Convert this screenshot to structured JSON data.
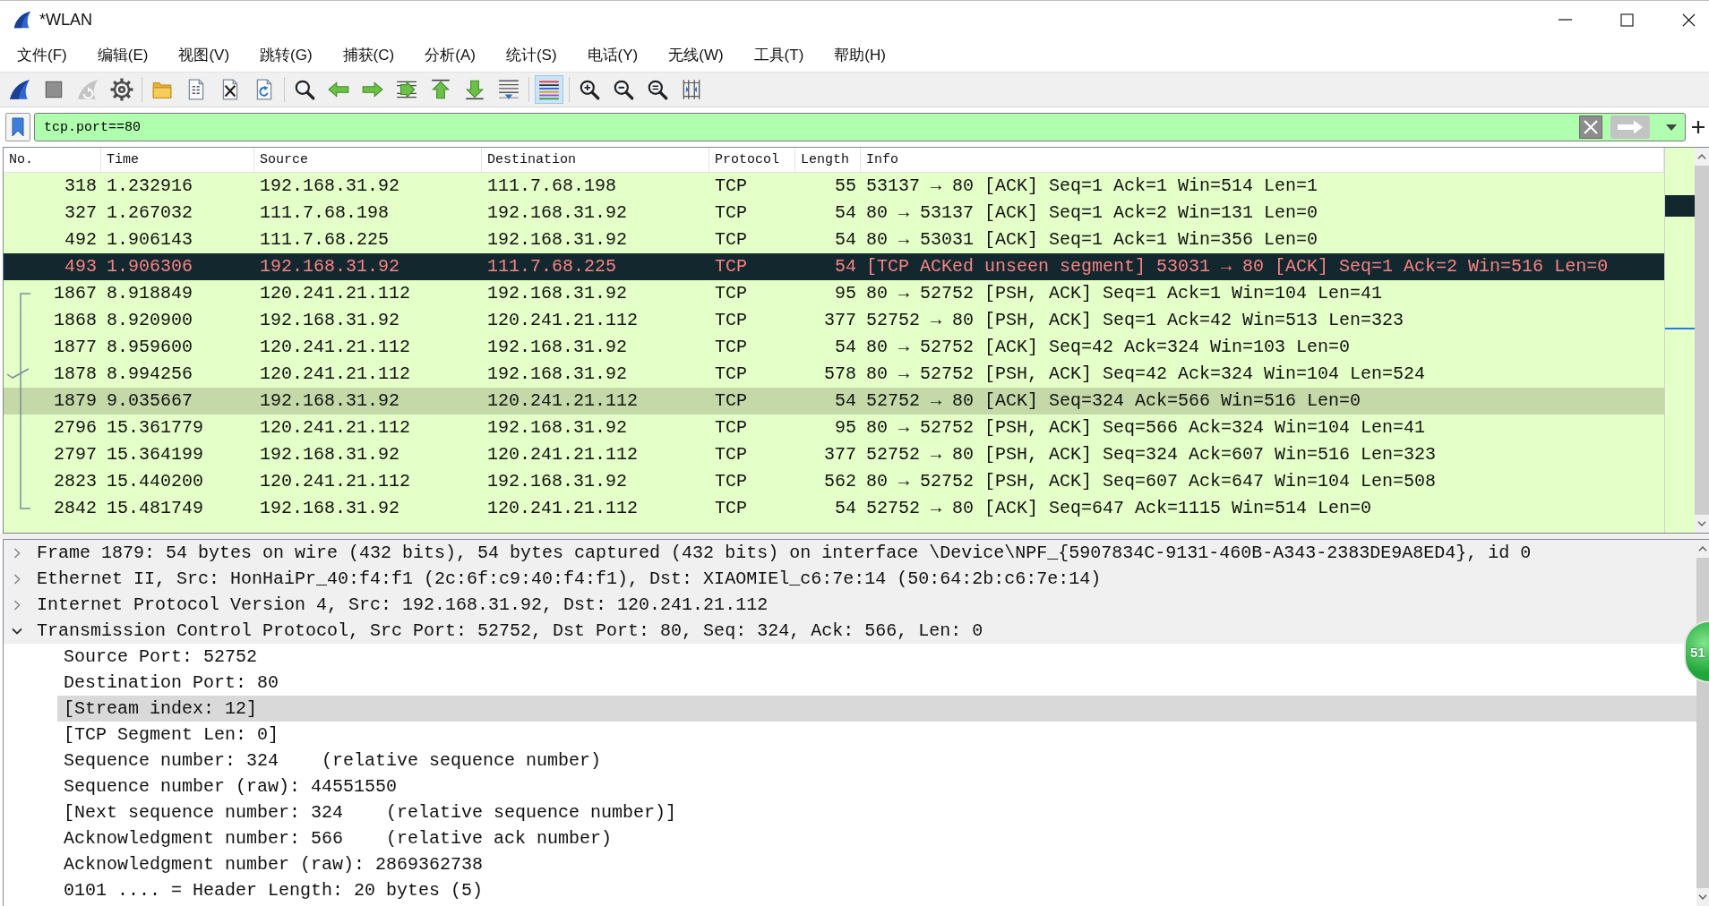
{
  "window": {
    "title": "*WLAN"
  },
  "menu": [
    "文件(F)",
    "编辑(E)",
    "视图(V)",
    "跳转(G)",
    "捕获(C)",
    "分析(A)",
    "统计(S)",
    "电话(Y)",
    "无线(W)",
    "工具(T)",
    "帮助(H)"
  ],
  "toolbar": [
    {
      "buttons": [
        {
          "kind": "start",
          "pressed": false
        },
        {
          "kind": "stop",
          "pressed": false
        },
        {
          "kind": "restart",
          "pressed": false
        },
        {
          "kind": "options",
          "pressed": false
        }
      ]
    },
    {
      "buttons": [
        {
          "kind": "open",
          "pressed": false
        },
        {
          "kind": "save",
          "pressed": false
        },
        {
          "kind": "close",
          "pressed": false
        },
        {
          "kind": "reload",
          "pressed": false
        }
      ]
    },
    {
      "buttons": [
        {
          "kind": "find",
          "pressed": false
        },
        {
          "kind": "back",
          "pressed": false
        },
        {
          "kind": "forward",
          "pressed": false
        },
        {
          "kind": "goto",
          "pressed": false
        },
        {
          "kind": "first",
          "pressed": false
        },
        {
          "kind": "last",
          "pressed": false
        },
        {
          "kind": "autoscroll",
          "pressed": false
        }
      ]
    },
    {
      "buttons": [
        {
          "kind": "colorize",
          "pressed": true
        }
      ]
    },
    {
      "buttons": [
        {
          "kind": "zoomin",
          "pressed": false
        },
        {
          "kind": "zoomout",
          "pressed": false
        },
        {
          "kind": "zoomreset",
          "pressed": false
        },
        {
          "kind": "resize",
          "pressed": false
        }
      ]
    }
  ],
  "display_filter": {
    "value": "tcp.port==80",
    "valid": true
  },
  "packet_list": {
    "columns": [
      "No.",
      "Time",
      "Source",
      "Destination",
      "Protocol",
      "Length",
      "Info"
    ],
    "rows": [
      {
        "no": "318",
        "time": "1.232916",
        "source": "192.168.31.92",
        "destination": "111.7.68.198",
        "protocol": "TCP",
        "length": "55",
        "info": "53137 → 80 [ACK] Seq=1 Ack=1 Win=514 Len=1",
        "kind": "normal",
        "selected": false,
        "related": false,
        "acked": false
      },
      {
        "no": "327",
        "time": "1.267032",
        "source": "111.7.68.198",
        "destination": "192.168.31.92",
        "protocol": "TCP",
        "length": "54",
        "info": "80 → 53137 [ACK] Seq=1 Ack=2 Win=131 Len=0",
        "kind": "normal",
        "selected": false,
        "related": false,
        "acked": false
      },
      {
        "no": "492",
        "time": "1.906143",
        "source": "111.7.68.225",
        "destination": "192.168.31.92",
        "protocol": "TCP",
        "length": "54",
        "info": "80 → 53031 [ACK] Seq=1 Ack=1 Win=356 Len=0",
        "kind": "normal",
        "selected": false,
        "related": false,
        "acked": false
      },
      {
        "no": "493",
        "time": "1.906306",
        "source": "192.168.31.92",
        "destination": "111.7.68.225",
        "protocol": "TCP",
        "length": "54",
        "info": "[TCP ACKed unseen segment] 53031 → 80 [ACK] Seq=1 Ack=2 Win=516 Len=0",
        "kind": "bad",
        "selected": false,
        "related": false,
        "acked": false
      },
      {
        "no": "1867",
        "time": "8.918849",
        "source": "120.241.21.112",
        "destination": "192.168.31.92",
        "protocol": "TCP",
        "length": "95",
        "info": "80 → 52752 [PSH, ACK] Seq=1 Ack=1 Win=104 Len=41",
        "kind": "normal",
        "selected": false,
        "related": true,
        "acked": false
      },
      {
        "no": "1868",
        "time": "8.920900",
        "source": "192.168.31.92",
        "destination": "120.241.21.112",
        "protocol": "TCP",
        "length": "377",
        "info": "52752 → 80 [PSH, ACK] Seq=1 Ack=42 Win=513 Len=323",
        "kind": "normal",
        "selected": false,
        "related": true,
        "acked": false
      },
      {
        "no": "1877",
        "time": "8.959600",
        "source": "120.241.21.112",
        "destination": "192.168.31.92",
        "protocol": "TCP",
        "length": "54",
        "info": "80 → 52752 [ACK] Seq=42 Ack=324 Win=103 Len=0",
        "kind": "normal",
        "selected": false,
        "related": true,
        "acked": false
      },
      {
        "no": "1878",
        "time": "8.994256",
        "source": "120.241.21.112",
        "destination": "192.168.31.92",
        "protocol": "TCP",
        "length": "578",
        "info": "80 → 52752 [PSH, ACK] Seq=42 Ack=324 Win=104 Len=524",
        "kind": "normal",
        "selected": false,
        "related": true,
        "acked": true
      },
      {
        "no": "1879",
        "time": "9.035667",
        "source": "192.168.31.92",
        "destination": "120.241.21.112",
        "protocol": "TCP",
        "length": "54",
        "info": "52752 → 80 [ACK] Seq=324 Ack=566 Win=516 Len=0",
        "kind": "normal",
        "selected": true,
        "related": true,
        "acked": false
      },
      {
        "no": "2796",
        "time": "15.361779",
        "source": "120.241.21.112",
        "destination": "192.168.31.92",
        "protocol": "TCP",
        "length": "95",
        "info": "80 → 52752 [PSH, ACK] Seq=566 Ack=324 Win=104 Len=41",
        "kind": "normal",
        "selected": false,
        "related": true,
        "acked": false
      },
      {
        "no": "2797",
        "time": "15.364199",
        "source": "192.168.31.92",
        "destination": "120.241.21.112",
        "protocol": "TCP",
        "length": "377",
        "info": "52752 → 80 [PSH, ACK] Seq=324 Ack=607 Win=516 Len=323",
        "kind": "normal",
        "selected": false,
        "related": true,
        "acked": false
      },
      {
        "no": "2823",
        "time": "15.440200",
        "source": "120.241.21.112",
        "destination": "192.168.31.92",
        "protocol": "TCP",
        "length": "562",
        "info": "80 → 52752 [PSH, ACK] Seq=607 Ack=647 Win=104 Len=508",
        "kind": "normal",
        "selected": false,
        "related": true,
        "acked": false
      },
      {
        "no": "2842",
        "time": "15.481749",
        "source": "192.168.31.92",
        "destination": "120.241.21.112",
        "protocol": "TCP",
        "length": "54",
        "info": "52752 → 80 [ACK] Seq=647 Ack=1115 Win=514 Len=0",
        "kind": "normal",
        "selected": false,
        "related": true,
        "acked": false
      }
    ]
  },
  "details": [
    {
      "text": "Frame 1879: 54 bytes on wire (432 bits), 54 bytes captured (432 bits) on interface \\Device\\NPF_{5907834C-9131-460B-A343-2383DE9A8ED4}, id 0",
      "expanded": false,
      "selected": false
    },
    {
      "text": "Ethernet II, Src: HonHaiPr_40:f4:f1 (2c:6f:c9:40:f4:f1), Dst: XIAOMIEl_c6:7e:14 (50:64:2b:c6:7e:14)",
      "expanded": false,
      "selected": false
    },
    {
      "text": "Internet Protocol Version 4, Src: 192.168.31.92, Dst: 120.241.21.112",
      "expanded": false,
      "selected": false
    },
    {
      "text": "Transmission Control Protocol, Src Port: 52752, Dst Port: 80, Seq: 324, Ack: 566, Len: 0",
      "expanded": true,
      "selected": false,
      "children": [
        {
          "text": "Source Port: 52752",
          "selected": false
        },
        {
          "text": "Destination Port: 80",
          "selected": false
        },
        {
          "text": "[Stream index: 12]",
          "selected": true
        },
        {
          "text": "[TCP Segment Len: 0]",
          "selected": false
        },
        {
          "text": "Sequence number: 324    (relative sequence number)",
          "selected": false
        },
        {
          "text": "Sequence number (raw): 44551550",
          "selected": false
        },
        {
          "text": "[Next sequence number: 324    (relative sequence number)]",
          "selected": false
        },
        {
          "text": "Acknowledgment number: 566    (relative ack number)",
          "selected": false
        },
        {
          "text": "Acknowledgment number (raw): 2869362738",
          "selected": false
        },
        {
          "text": "0101 .... = Header Length: 20 bytes (5)",
          "selected": false
        }
      ]
    }
  ],
  "overlay_badge": {
    "text": "51"
  }
}
